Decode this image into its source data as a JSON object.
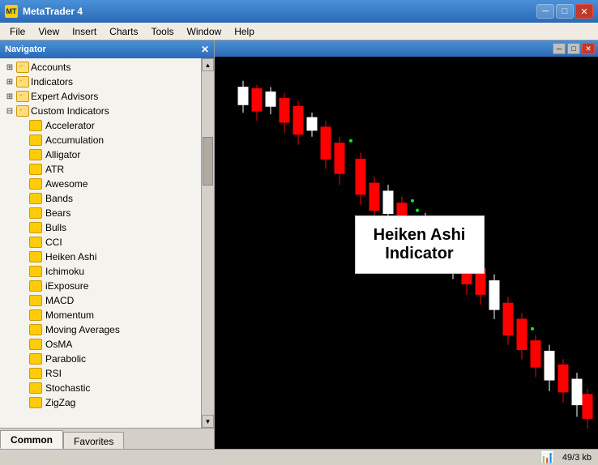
{
  "titleBar": {
    "title": "MetaTrader 4",
    "icon": "MT",
    "buttons": {
      "minimize": "─",
      "maximize": "□",
      "close": "✕"
    }
  },
  "menuBar": {
    "items": [
      "File",
      "View",
      "Insert",
      "Charts",
      "Tools",
      "Window",
      "Help"
    ]
  },
  "innerTitleBar": {
    "buttons": {
      "minimize": "─",
      "maximize": "□",
      "close": "✕"
    }
  },
  "navigator": {
    "title": "Navigator",
    "closeLabel": "✕",
    "tree": {
      "accounts": {
        "label": "Accounts",
        "expanded": false
      },
      "indicators": {
        "label": "Indicators",
        "expanded": false
      },
      "expertAdvisors": {
        "label": "Expert Advisors",
        "expanded": false
      },
      "customIndicators": {
        "label": "Custom Indicators",
        "expanded": true,
        "children": [
          "Accelerator",
          "Accumulation",
          "Alligator",
          "ATR",
          "Awesome",
          "Bands",
          "Bears",
          "Bulls",
          "CCI",
          "Heiken Ashi",
          "Ichimoku",
          "iExposure",
          "MACD",
          "Momentum",
          "Moving Averages",
          "OsMA",
          "Parabolic",
          "RSI",
          "Stochastic",
          "ZigZag"
        ]
      }
    },
    "tabs": [
      "Common",
      "Favorites"
    ]
  },
  "chart": {
    "label": "Heiken Ashi\nIndicator"
  },
  "statusBar": {
    "kbLabel": "49/3 kb"
  }
}
